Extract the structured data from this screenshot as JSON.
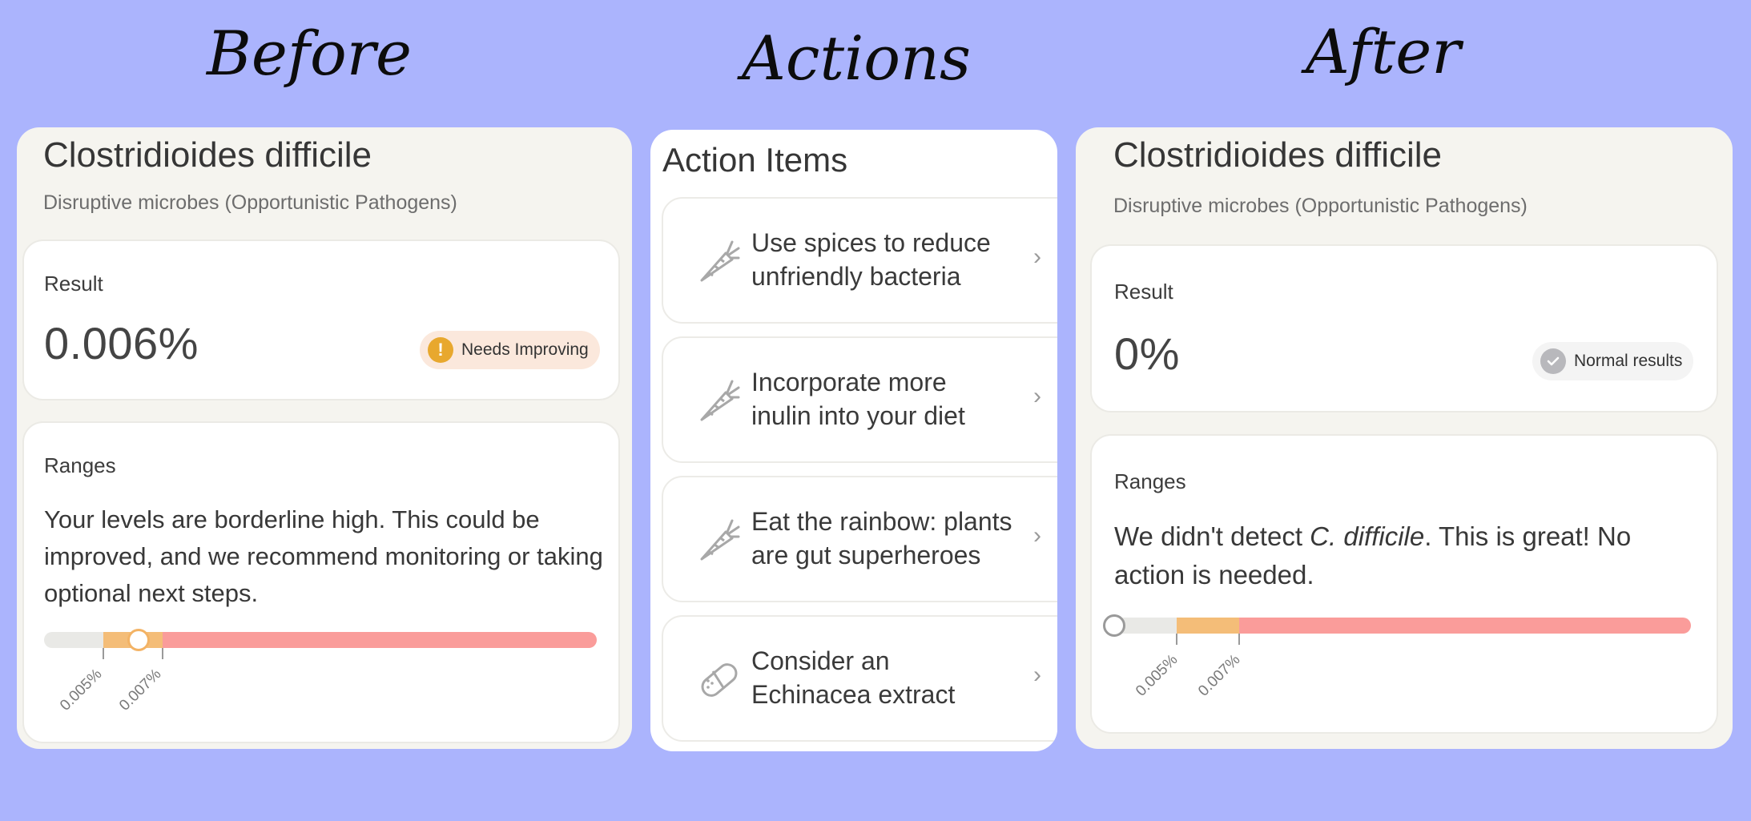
{
  "titles": {
    "before": "Before",
    "actions": "Actions",
    "after": "After"
  },
  "before": {
    "title": "Clostridioides difficile",
    "subtitle": "Disruptive microbes (Opportunistic Pathogens)",
    "result_label": "Result",
    "value": "0.006%",
    "badge": {
      "label": "Needs Improving",
      "icon": "exclamation-icon",
      "color": "#e8a82e",
      "bg": "#fbe8dc"
    },
    "ranges_label": "Ranges",
    "ranges_text": "Your levels are borderline high. This could be improved, and we recommend monitoring or taking optional next steps.",
    "ticks": [
      "0.005%",
      "0.007%"
    ],
    "marker_position": 0.006
  },
  "actions": {
    "title": "Action Items",
    "items": [
      {
        "line1": "Use spices to reduce",
        "line2": "unfriendly bacteria",
        "icon": "carrot-icon"
      },
      {
        "line1": "Incorporate more",
        "line2": "inulin into your diet",
        "icon": "carrot-icon"
      },
      {
        "line1": "Eat the rainbow: plants",
        "line2": "are gut superheroes",
        "icon": "carrot-icon"
      },
      {
        "line1": "Consider an",
        "line2": "Echinacea extract",
        "icon": "pill-icon"
      }
    ]
  },
  "after": {
    "title": "Clostridioides difficile",
    "subtitle": "Disruptive microbes (Opportunistic Pathogens)",
    "result_label": "Result",
    "value": "0%",
    "badge": {
      "label": "Normal results",
      "icon": "check-icon",
      "color": "#b8b8bc",
      "bg": "#f4f4f4"
    },
    "ranges_label": "Ranges",
    "ranges_text_a": "We didn't detect ",
    "ranges_text_em": "C. difficile",
    "ranges_text_b": ". This is great! No action is needed.",
    "ticks": [
      "0.005%",
      "0.007%"
    ],
    "marker_position": 0
  },
  "colors": {
    "background": "#abb4fd",
    "range_low": "#e9e9e6",
    "range_mid": "#f4bd78",
    "range_high": "#fa9c9a"
  }
}
